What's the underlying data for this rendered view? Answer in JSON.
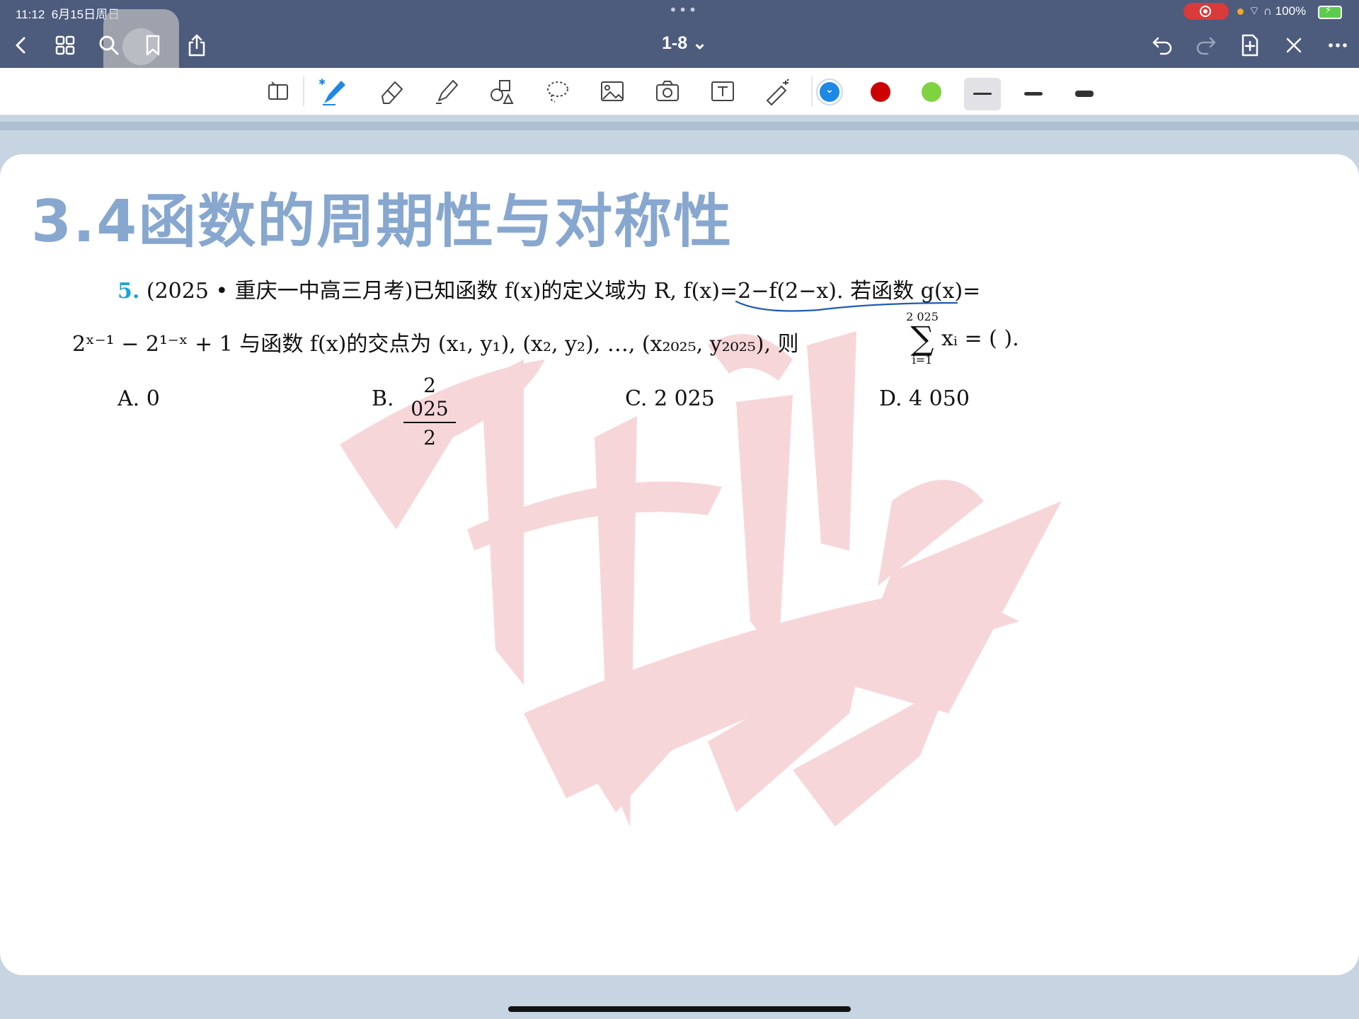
{
  "status_bar": {
    "time": "11:12",
    "date": "6月15日周日",
    "battery": "100%"
  },
  "toolbar": {
    "doc_title": "1-8 ⌄"
  },
  "colors": {
    "bar": "#4d5b7d",
    "blue": "#1e88e5",
    "red": "#cc0000",
    "green": "#7ed33f",
    "heading": "#87a7cf"
  },
  "icons": {
    "back": "chevron-left-icon",
    "grid": "grid-icon",
    "search": "search-icon",
    "bookmark": "bookmark-icon",
    "share": "share-icon",
    "undo": "undo-icon",
    "redo": "redo-icon",
    "add_page": "add-page-icon",
    "close": "close-icon",
    "more": "more-icon"
  },
  "document": {
    "heading": "3.4函数的周期性与对称性",
    "question_number": "5.",
    "line1": "(2025 • 重庆一中高三月考)已知函数 f(x)的定义域为 R, f(x)=2−f(2−x). 若函数 g(x)=",
    "line2": "2ˣ⁻¹ − 2¹⁻ˣ + 1 与函数 f(x)的交点为 (x₁, y₁), (x₂, y₂), …, (x₂₀₂₅, y₂₀₂₅), 则",
    "line2_tail": "xᵢ = (      ).",
    "sum_upper": "2 025",
    "sum_lower": "i=1",
    "option_a": "A.  0",
    "option_b_label": "B.",
    "option_b_num": "2 025",
    "option_b_den": "2",
    "option_c": "C.  2 025",
    "option_d": "D.  4 050"
  }
}
